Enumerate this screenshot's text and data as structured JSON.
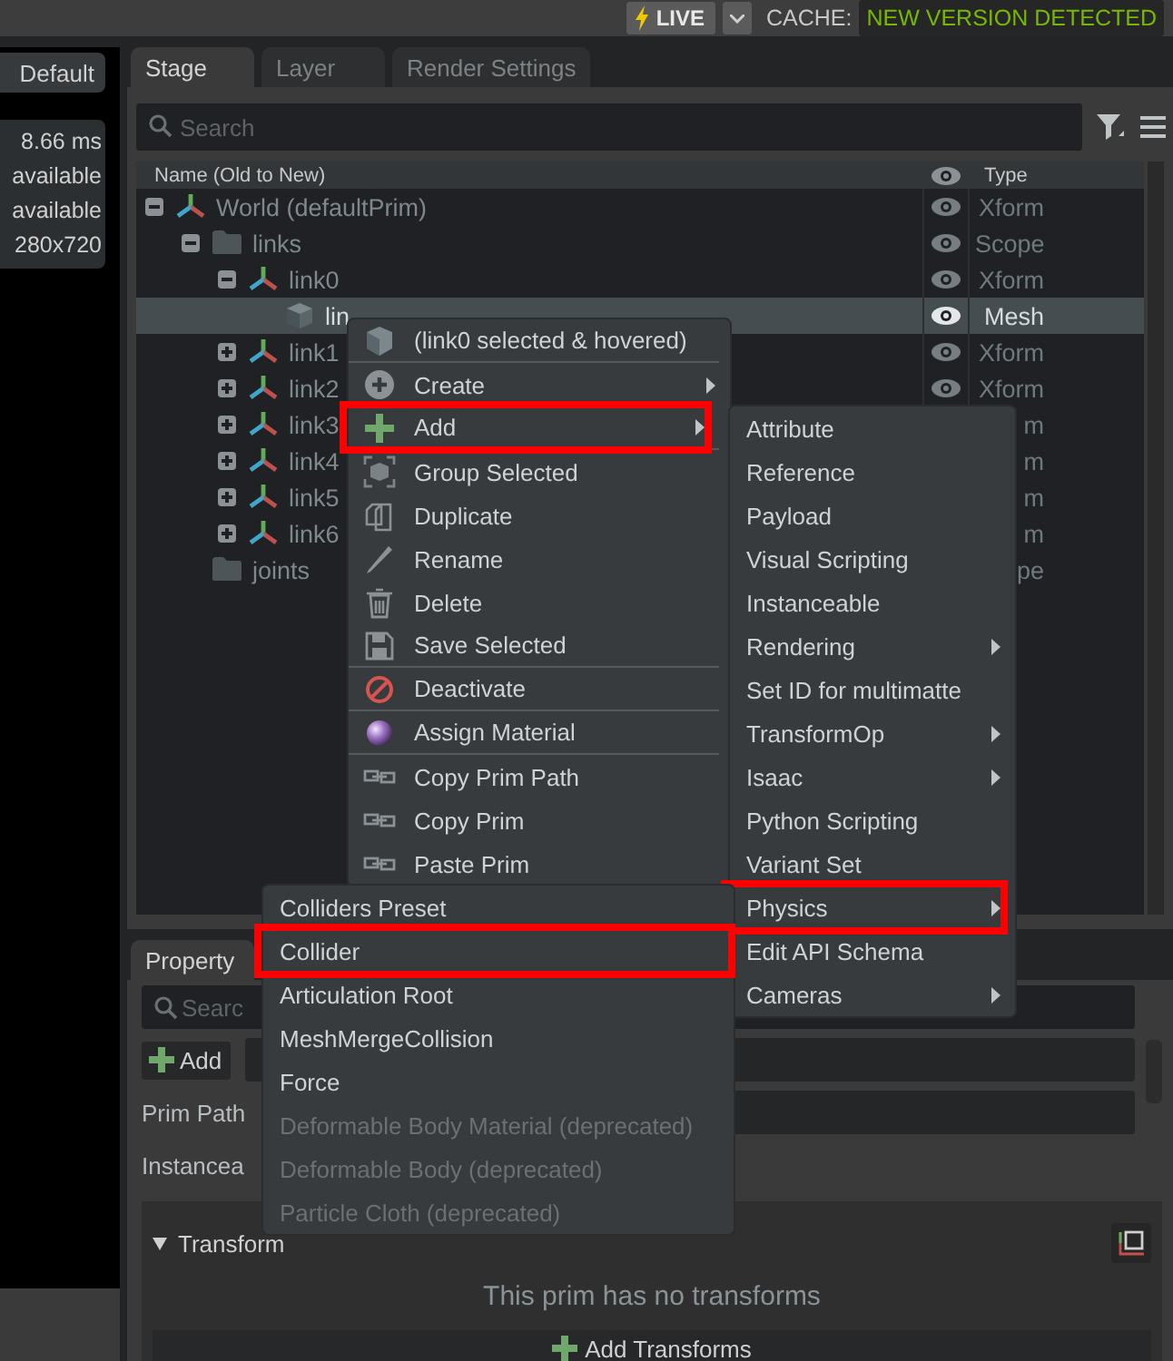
{
  "topbar": {
    "live": "LIVE",
    "cache_label": "CACHE:",
    "cache_status": "NEW VERSION DETECTED"
  },
  "viewport": {
    "camera_button": "Default",
    "stats": [
      "8.66 ms",
      "available",
      "available",
      "280x720"
    ]
  },
  "stage_panel": {
    "tabs": [
      {
        "label": "Stage",
        "selected": true
      },
      {
        "label": "Layer",
        "selected": false
      },
      {
        "label": "Render Settings",
        "selected": false
      }
    ],
    "search": {
      "placeholder": "Search"
    },
    "columns": [
      "Name (Old to New)",
      "Type"
    ],
    "tree": [
      {
        "name": "World (defaultPrim)",
        "kind": "xform",
        "type": "Xform",
        "eye": true,
        "expanded": true,
        "selected": false,
        "children": [
          {
            "name": "links",
            "kind": "scope",
            "type": "Scope",
            "eye": true,
            "expanded": true,
            "selected": false,
            "children": [
              {
                "name": "link0",
                "kind": "xform",
                "type": "Xform",
                "eye": true,
                "expanded": true,
                "selected": false,
                "children": [
                  {
                    "name": "lin",
                    "kind": "mesh",
                    "type": "Mesh",
                    "eye": true,
                    "selected": true
                  }
                ]
              },
              {
                "name": "link1",
                "kind": "xform",
                "type": "Xform",
                "eye": true,
                "expanded": false,
                "selected": false
              },
              {
                "name": "link2",
                "kind": "xform",
                "type": "Xform",
                "eye": true,
                "expanded": false,
                "selected": false
              },
              {
                "name": "link3",
                "kind": "xform",
                "type": "m",
                "eye": false,
                "expanded": false,
                "selected": false
              },
              {
                "name": "link4",
                "kind": "xform",
                "type": "m",
                "eye": false,
                "expanded": false,
                "selected": false
              },
              {
                "name": "link5",
                "kind": "xform",
                "type": "m",
                "eye": false,
                "expanded": false,
                "selected": false
              },
              {
                "name": "link6",
                "kind": "xform",
                "type": "m",
                "eye": false,
                "expanded": false,
                "selected": false
              }
            ]
          },
          {
            "name": "joints",
            "kind": "scope",
            "type": "pe",
            "eye": false,
            "selected": false
          }
        ]
      }
    ]
  },
  "property_panel": {
    "tab": "Property",
    "search": {
      "placeholder": "Searc"
    },
    "add_button": "Add",
    "labels": [
      "Prim Path",
      "Instancea"
    ],
    "transform": {
      "title": "Transform",
      "expanded": true,
      "message": "This prim has no transforms",
      "button": "Add Transforms"
    }
  },
  "context_menu": {
    "items": [
      {
        "label": "(link0 selected & hovered)",
        "kind": "header",
        "submenu": false,
        "highlighted": false
      },
      {
        "label": "Create",
        "kind": "item",
        "submenu": true,
        "highlighted": false
      },
      {
        "label": "Add",
        "kind": "item",
        "submenu": true,
        "highlighted": true
      },
      {
        "label": "Group Selected",
        "kind": "item",
        "submenu": false,
        "highlighted": false
      },
      {
        "label": "Duplicate",
        "kind": "item",
        "submenu": false,
        "highlighted": false
      },
      {
        "label": "Rename",
        "kind": "item",
        "submenu": false,
        "highlighted": false
      },
      {
        "label": "Delete",
        "kind": "item",
        "submenu": false,
        "highlighted": false
      },
      {
        "label": "Save Selected",
        "kind": "item",
        "submenu": false,
        "highlighted": false
      },
      {
        "label": "Deactivate",
        "kind": "item",
        "submenu": false,
        "highlighted": false
      },
      {
        "label": "Assign Material",
        "kind": "item",
        "submenu": false,
        "highlighted": false
      },
      {
        "label": "Copy Prim Path",
        "kind": "item",
        "submenu": false,
        "highlighted": false
      },
      {
        "label": "Copy Prim",
        "kind": "item",
        "submenu": false,
        "highlighted": false
      },
      {
        "label": "Paste Prim",
        "kind": "item",
        "submenu": false,
        "highlighted": false
      }
    ]
  },
  "add_submenu": {
    "items": [
      {
        "label": "Attribute",
        "submenu": false,
        "highlighted": false
      },
      {
        "label": "Reference",
        "submenu": false,
        "highlighted": false
      },
      {
        "label": "Payload",
        "submenu": false,
        "highlighted": false
      },
      {
        "label": "Visual Scripting",
        "submenu": false,
        "highlighted": false
      },
      {
        "label": "Instanceable",
        "submenu": false,
        "highlighted": false
      },
      {
        "label": "Rendering",
        "submenu": true,
        "highlighted": false
      },
      {
        "label": "Set ID for multimatte",
        "submenu": false,
        "highlighted": false
      },
      {
        "label": "TransformOp",
        "submenu": true,
        "highlighted": false
      },
      {
        "label": "Isaac",
        "submenu": true,
        "highlighted": false
      },
      {
        "label": "Python Scripting",
        "submenu": false,
        "highlighted": false
      },
      {
        "label": "Variant Set",
        "submenu": false,
        "highlighted": false
      },
      {
        "label": "Physics",
        "submenu": true,
        "highlighted": true
      },
      {
        "label": "Edit API Schema",
        "submenu": false,
        "highlighted": false
      },
      {
        "label": "Cameras",
        "submenu": true,
        "highlighted": false
      }
    ]
  },
  "physics_submenu": {
    "items": [
      {
        "label": "Colliders Preset",
        "disabled": false,
        "highlighted": false
      },
      {
        "label": "Collider",
        "disabled": false,
        "highlighted": true
      },
      {
        "label": "Articulation Root",
        "disabled": false,
        "highlighted": false
      },
      {
        "label": "MeshMergeCollision",
        "disabled": false,
        "highlighted": false
      },
      {
        "label": "Force",
        "disabled": false,
        "highlighted": false
      },
      {
        "label": "Deformable Body Material (deprecated)",
        "disabled": true,
        "highlighted": false
      },
      {
        "label": "Deformable Body (deprecated)",
        "disabled": true,
        "highlighted": false
      },
      {
        "label": "Particle Cloth (deprecated)",
        "disabled": true,
        "highlighted": false
      }
    ]
  }
}
